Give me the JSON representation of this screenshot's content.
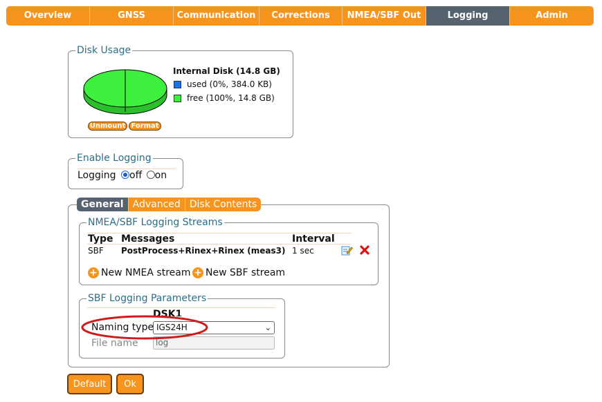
{
  "nav": {
    "tabs": [
      {
        "label": "Overview",
        "active": false
      },
      {
        "label": "GNSS",
        "active": false
      },
      {
        "label": "Communication",
        "active": false
      },
      {
        "label": "Corrections",
        "active": false
      },
      {
        "label": "NMEA/SBF Out",
        "active": false
      },
      {
        "label": "Logging",
        "active": true
      },
      {
        "label": "Admin",
        "active": false
      }
    ]
  },
  "disk_usage": {
    "legend": "Disk Usage",
    "title": "Internal Disk (14.8 GB)",
    "used_label": "used (0%, 384.0 KB)",
    "free_label": "free (100%, 14.8 GB)",
    "used_color": "#1a73e8",
    "free_color": "#3df03d",
    "unmount_label": "Unmount",
    "format_label": "Format"
  },
  "enable_logging": {
    "legend": "Enable Logging",
    "label": "Logging",
    "off_label": "off",
    "on_label": "on",
    "selected": "off"
  },
  "subtabs": [
    {
      "label": "General",
      "active": true
    },
    {
      "label": "Advanced",
      "active": false
    },
    {
      "label": "Disk Contents",
      "active": false
    }
  ],
  "streams": {
    "legend": "NMEA/SBF Logging Streams",
    "headers": {
      "type": "Type",
      "messages": "Messages",
      "interval": "Interval"
    },
    "rows": [
      {
        "type": "SBF",
        "messages": "PostProcess+Rinex+Rinex (meas3)",
        "interval": "1 sec"
      }
    ],
    "new_nmea_label": "New NMEA stream",
    "new_sbf_label": "New SBF stream"
  },
  "sbf_params": {
    "legend": "SBF Logging Parameters",
    "column_header": "DSK1",
    "naming_type_label": "Naming type",
    "naming_type_value": "IGS24H",
    "file_name_label": "File name",
    "file_name_value": "log"
  },
  "buttons": {
    "default_label": "Default",
    "ok_label": "Ok"
  },
  "annotation_color": "#d11a1a",
  "accent_color": "#f7941d"
}
